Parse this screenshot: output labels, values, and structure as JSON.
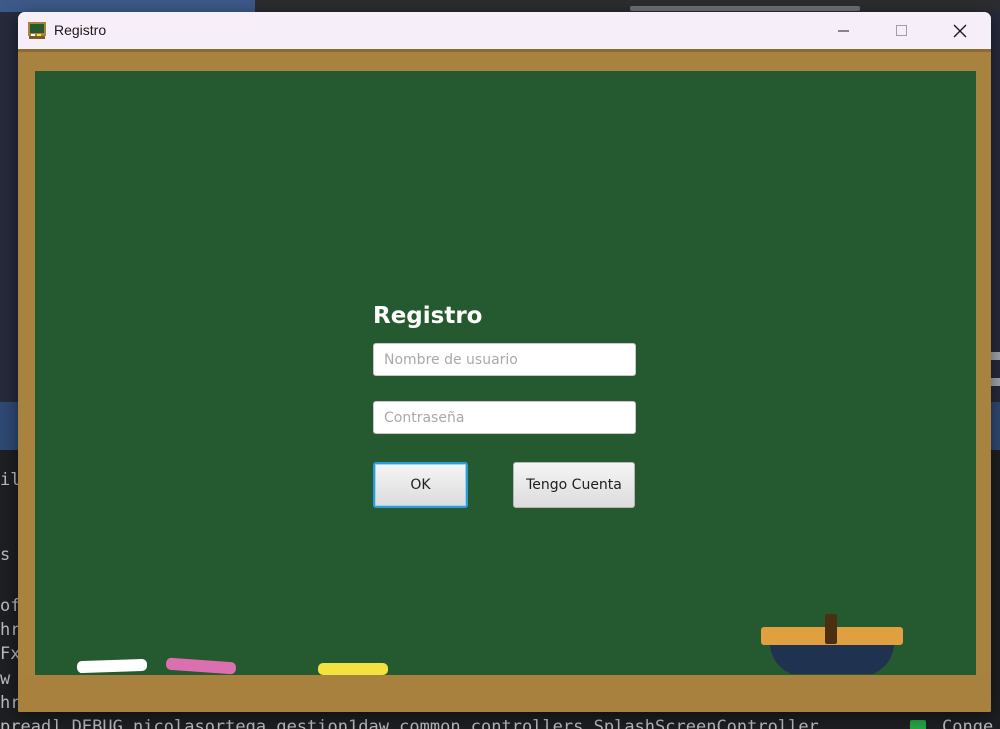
{
  "window": {
    "title": "Registro",
    "controls": [
      "minimize",
      "maximize",
      "close"
    ]
  },
  "form": {
    "heading": "Registro",
    "username_placeholder": "Nombre de usuario",
    "password_placeholder": "Contraseña",
    "ok_label": "OK",
    "account_label": "Tengo Cuenta"
  },
  "decorations": {
    "chalks": [
      "white",
      "pink",
      "yellow"
    ],
    "board_color": "#255a30",
    "frame_color": "#a88340"
  },
  "background_ide": {
    "console_fragments": [
      "ilda",
      "s",
      "of",
      "hre",
      "Fx",
      "w",
      "hre",
      "pread] DEBUG nicolasortega.gestion1daw.common.controllers.SplashScreenController"
    ],
    "right_fragment": "Conge"
  },
  "colors": {
    "accent": "#2d9bd8",
    "title_bar": "#f6eef8"
  }
}
